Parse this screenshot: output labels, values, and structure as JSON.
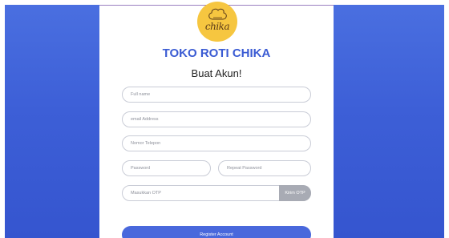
{
  "brand": {
    "logo_text": "chika",
    "shop_name": "TOKO ROTI CHIKA"
  },
  "form": {
    "heading": "Buat Akun!",
    "full_name_placeholder": "Full name",
    "email_placeholder": "email Address",
    "phone_placeholder": "Nomor Telepon",
    "password_placeholder": "Password",
    "repeat_password_placeholder": "Repeat Password",
    "otp_placeholder": "Masukkan OTP",
    "otp_button_label": "Kirim OTP",
    "register_button_label": "Register Account"
  },
  "colors": {
    "backdrop": "#3d5fd7",
    "brand_blue": "#3a5bd3",
    "logo_yellow": "#f6c640",
    "otp_button": "#a8abb4",
    "register_button": "#4968dc"
  }
}
